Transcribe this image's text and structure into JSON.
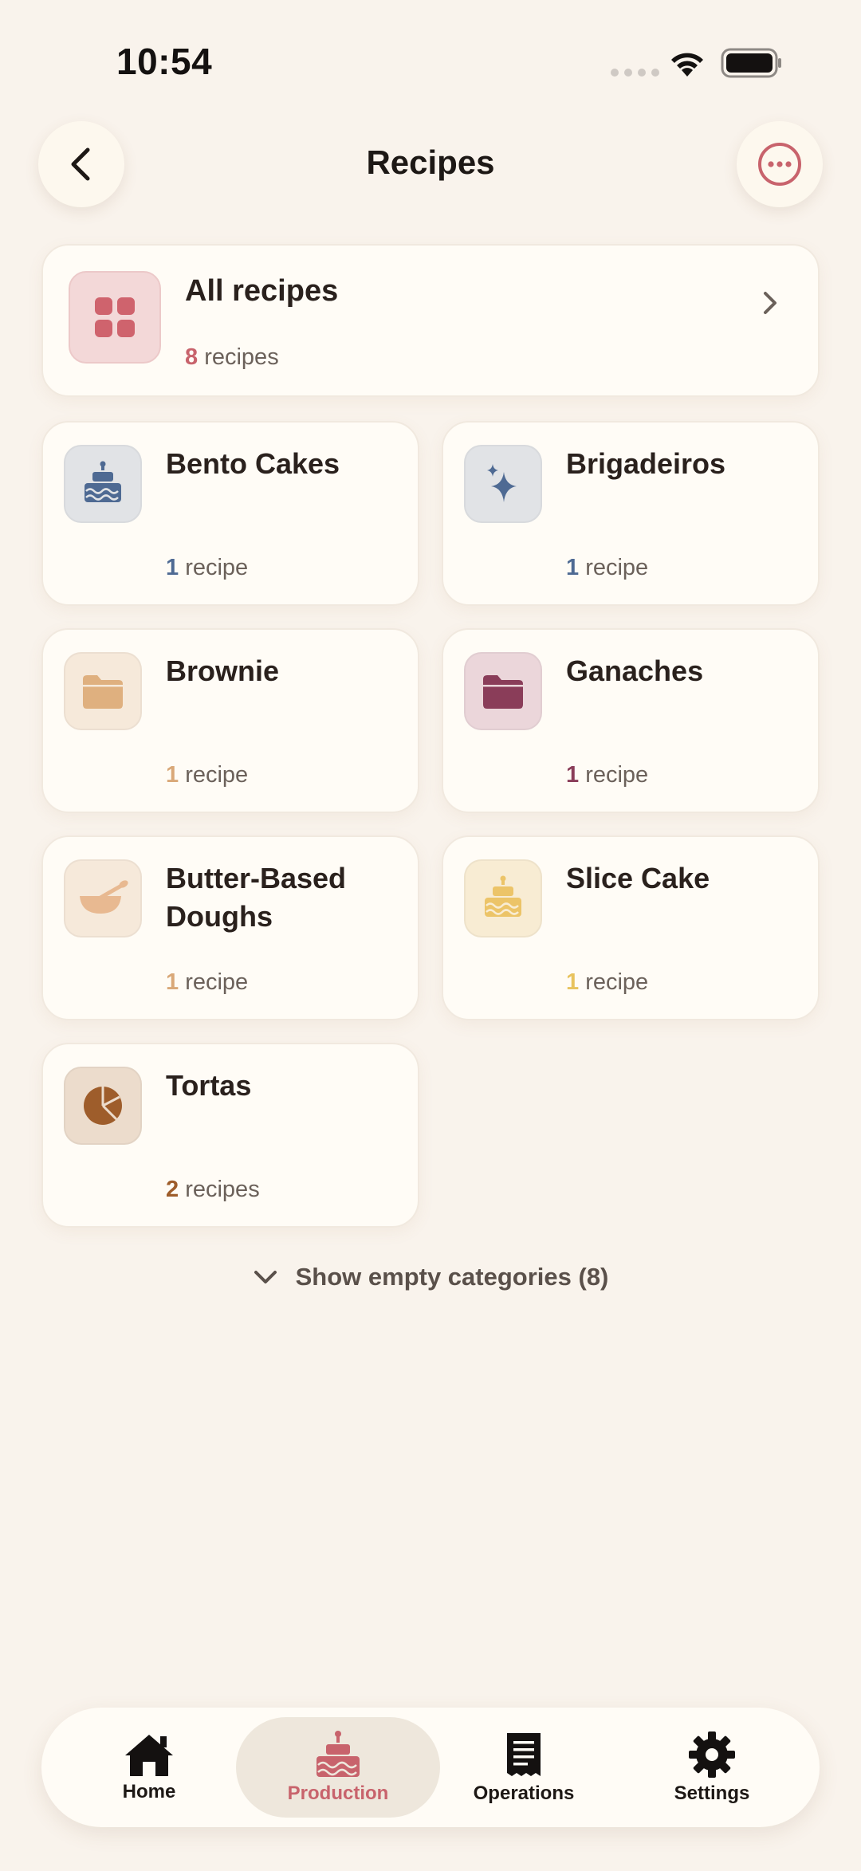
{
  "status_bar": {
    "time": "10:54"
  },
  "header": {
    "title": "Recipes",
    "back_icon": "chevron-left-icon",
    "more_icon": "ellipsis-circle-icon"
  },
  "all_recipes": {
    "name": "All recipes",
    "count": "8",
    "unit": "recipes",
    "accent": "#c8636c"
  },
  "categories": [
    {
      "name": "Bento Cakes",
      "count": "1",
      "unit": "recipe",
      "icon": "cake-icon",
      "accent": "#4e6a93",
      "tile": "#e1e3e6"
    },
    {
      "name": "Brigadeiros",
      "count": "1",
      "unit": "recipe",
      "icon": "sparkles-icon",
      "accent": "#4e6a93",
      "tile": "#e1e3e6"
    },
    {
      "name": "Brownie",
      "count": "1",
      "unit": "recipe",
      "icon": "folder-icon",
      "accent": "#d9a878",
      "tile": "#f6e9da"
    },
    {
      "name": "Ganaches",
      "count": "1",
      "unit": "recipe",
      "icon": "folder-icon",
      "accent": "#8a3d59",
      "tile": "#ebd6da"
    },
    {
      "name": "Butter-Based Doughs",
      "count": "1",
      "unit": "recipe",
      "icon": "mixing-bowl-icon",
      "accent": "#d9a878",
      "tile": "#f6e9da"
    },
    {
      "name": "Slice Cake",
      "count": "1",
      "unit": "recipe",
      "icon": "cake-icon",
      "accent": "#e8c35e",
      "tile": "#f8ecd3"
    },
    {
      "name": "Tortas",
      "count": "2",
      "unit": "recipes",
      "icon": "pie-chart-icon",
      "accent": "#9e5d2b",
      "tile": "#ecdccc"
    }
  ],
  "show_empty": {
    "label": "Show empty categories (8)"
  },
  "tabbar": {
    "tabs": [
      {
        "label": "Home",
        "icon": "house-icon"
      },
      {
        "label": "Production",
        "icon": "cake-icon",
        "active": true
      },
      {
        "label": "Operations",
        "icon": "receipt-icon"
      },
      {
        "label": "Settings",
        "icon": "gear-icon"
      }
    ]
  }
}
